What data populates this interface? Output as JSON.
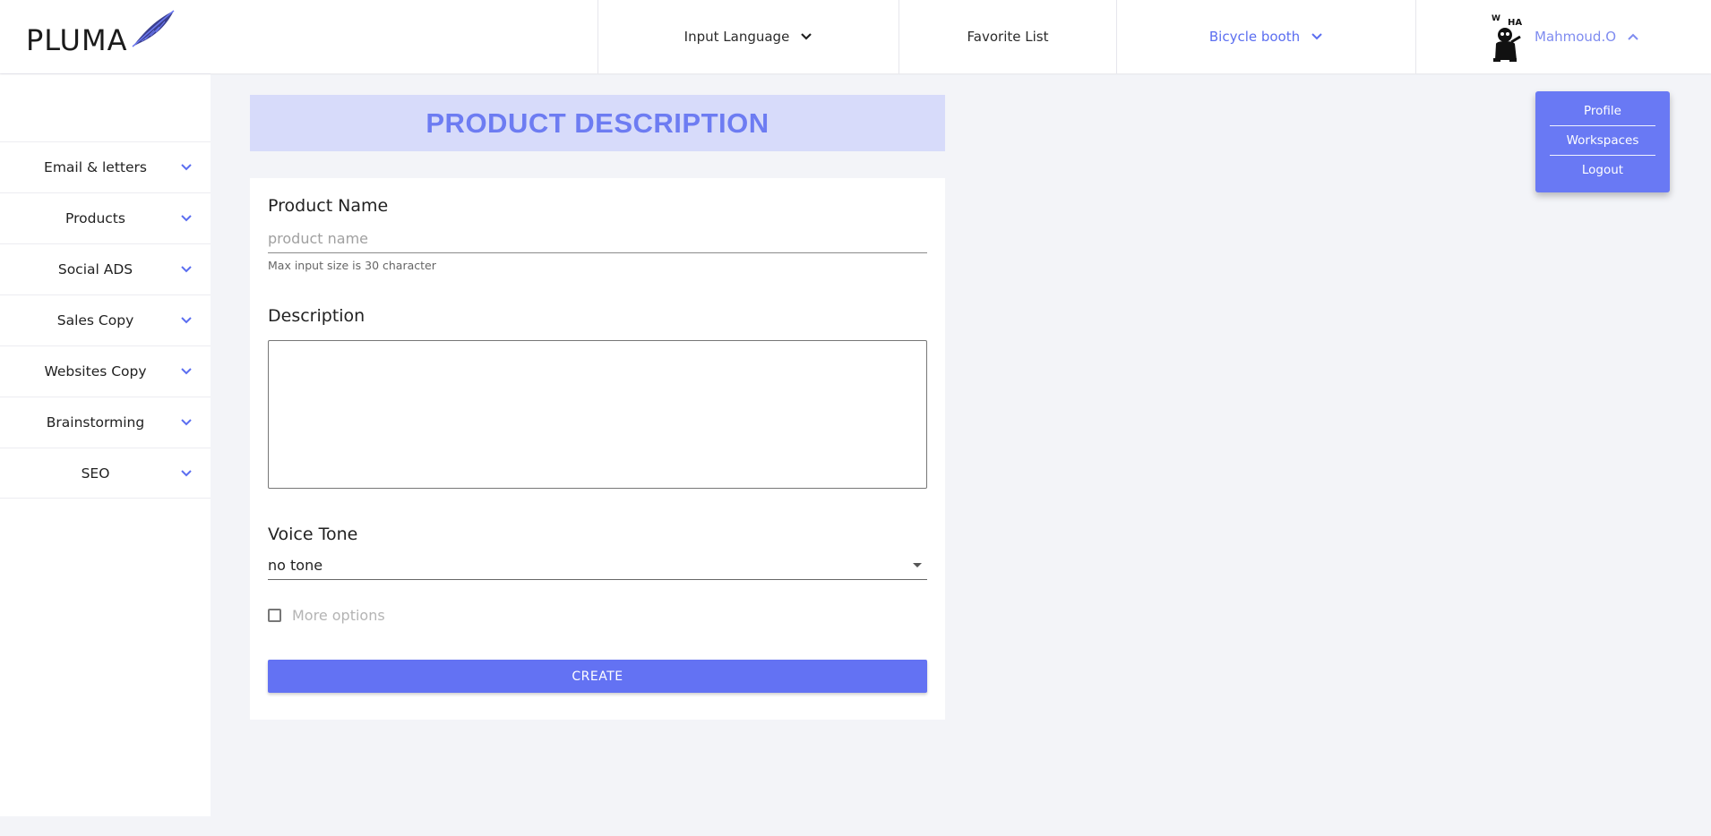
{
  "brand": {
    "name": "PLUMA"
  },
  "header": {
    "input_language": "Input Language",
    "favorite_list": "Favorite List",
    "workspace": "Bicycle booth",
    "user_name": "Mahmoud.O"
  },
  "sidebar": {
    "items": [
      {
        "label": "Email & letters"
      },
      {
        "label": "Products"
      },
      {
        "label": "Social ADS"
      },
      {
        "label": "Sales Copy"
      },
      {
        "label": "Websites Copy"
      },
      {
        "label": "Brainstorming"
      },
      {
        "label": "SEO"
      }
    ]
  },
  "page": {
    "title": "PRODUCT DESCRIPTION"
  },
  "form": {
    "product_name_label": "Product Name",
    "product_name_placeholder": "product name",
    "product_name_value": "",
    "product_name_hint": "Max input size is 30 character",
    "description_label": "Description",
    "description_value": "",
    "voice_tone_label": "Voice Tone",
    "voice_tone_value": "no tone",
    "more_options_label": "More options",
    "more_options_checked": false,
    "create_label": "CREATE"
  },
  "user_menu": {
    "items": [
      {
        "label": "Profile"
      },
      {
        "label": "Workspaces"
      },
      {
        "label": "Logout"
      }
    ]
  },
  "colors": {
    "accent": "#6372f3",
    "banner_bg": "#d7dbfa",
    "banner_text": "#6d7cf2",
    "page_bg": "#f3f4f8"
  },
  "icons": {
    "logo": "feather-icon",
    "dropdown": "chevron-down-icon",
    "user_menu_toggle": "chevron-up-icon",
    "select": "caret-down-icon"
  }
}
